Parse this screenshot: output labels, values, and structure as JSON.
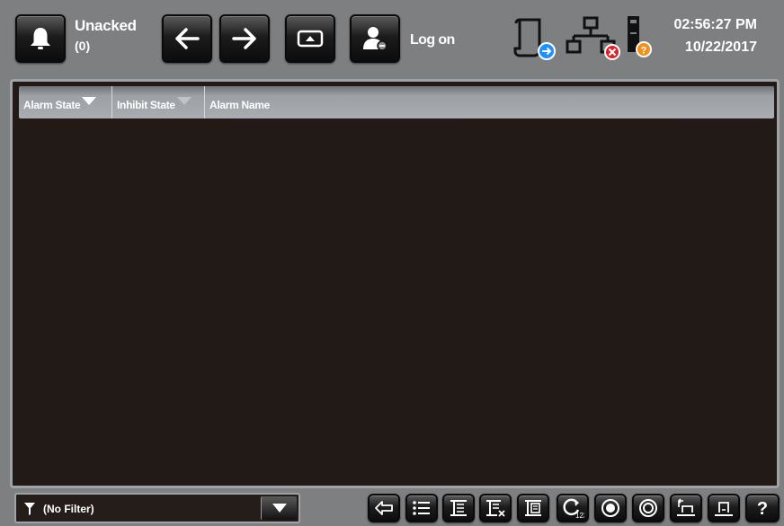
{
  "header": {
    "alarm_banner": {
      "label": "Unacked",
      "count": "(0)"
    },
    "logon_label": "Log on",
    "clock": {
      "time": "02:56:27 PM",
      "date": "10/22/2017"
    }
  },
  "alarm_table": {
    "columns": [
      {
        "label": "Alarm State",
        "sort_indicator": "triangle-down"
      },
      {
        "label": "Inhibit State",
        "sort_indicator": "triangle-down"
      },
      {
        "label": "Alarm Name"
      }
    ],
    "rows": []
  },
  "footer": {
    "filter": {
      "value": "(No Filter)"
    },
    "toolbar": [
      "back-arrow-icon",
      "list-icon",
      "select-icon",
      "deselect-icon",
      "details-icon",
      "reset-counts-icon",
      "acknowledge-icon",
      "acknowledge-all-icon",
      "shelve-icon",
      "unshelve-icon",
      "help-icon"
    ]
  },
  "colors": {
    "background": "#7e7f80",
    "table_bg": "#221a17",
    "header_gradient_light": "#a9adb2",
    "status_blue": "#1e90ff",
    "status_red": "#e0202a",
    "status_orange": "#f0901a"
  }
}
